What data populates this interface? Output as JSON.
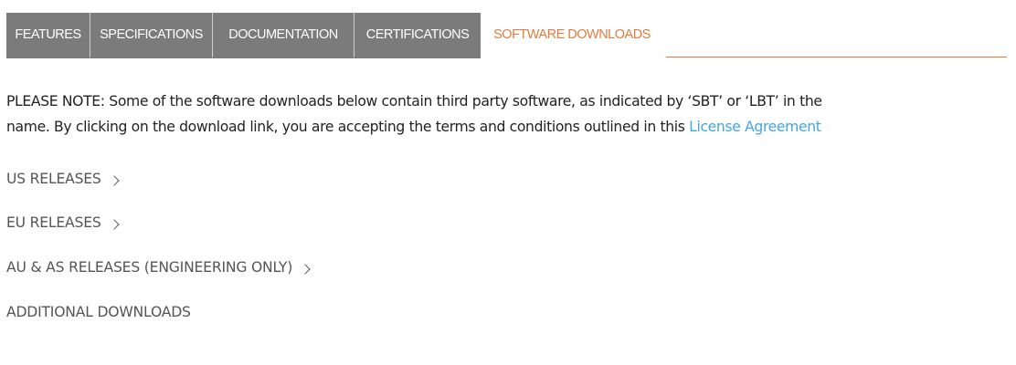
{
  "tabs": {
    "features": "FEATURES",
    "specifications": "SPECIFICATIONS",
    "documentation": "DOCUMENTATION",
    "certifications": "CERTIFICATIONS",
    "software_downloads": "SOFTWARE DOWNLOADS"
  },
  "notice": {
    "line1": "PLEASE NOTE: Some of the software downloads below contain third party software, as indicated by ‘SBT’ or ‘LBT’ in the",
    "line2_prefix": "name. By clicking on the download link, you are accepting the terms and conditions outlined in this ",
    "link_text": "License Agreement"
  },
  "sections": {
    "us": "US RELEASES",
    "eu": "EU RELEASES",
    "au_as": "AU & AS RELEASES (ENGINEERING ONLY)",
    "additional": "ADDITIONAL DOWNLOADS"
  },
  "colors": {
    "tab_bg": "#7b7b7b",
    "accent_orange": "#e07c3e",
    "link_blue": "#45a6e0"
  }
}
